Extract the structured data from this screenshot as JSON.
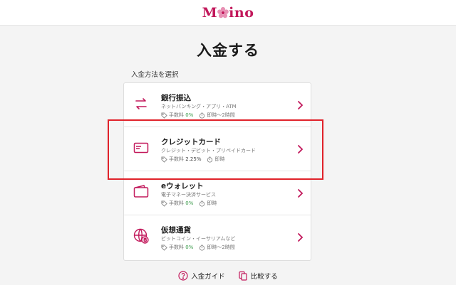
{
  "header": {
    "logo_text": "Mysino"
  },
  "page": {
    "title": "入金する",
    "section_label": "入金方法を選択"
  },
  "methods": [
    {
      "title": "銀行振込",
      "subtitle": "ネットバンキング・アプリ・ATM",
      "fee_label": "手数料",
      "fee_value": "0%",
      "time_label": "即時〜2時間",
      "icon": "bank-transfer-icon"
    },
    {
      "title": "クレジットカード",
      "subtitle": "クレジット・デビット・プリペイドカード",
      "fee_label": "手数料",
      "fee_value": "2.25%",
      "time_label": "即時",
      "icon": "credit-card-icon"
    },
    {
      "title": "eウォレット",
      "subtitle": "電子マネー決済サービス",
      "fee_label": "手数料",
      "fee_value": "0%",
      "time_label": "即時",
      "icon": "wallet-icon"
    },
    {
      "title": "仮想通貨",
      "subtitle": "ビットコイン・イーサリアムなど",
      "fee_label": "手数料",
      "fee_value": "0%",
      "time_label": "即時〜2時間",
      "icon": "crypto-icon"
    }
  ],
  "footer": {
    "guide_label": "入金ガイド",
    "compare_label": "比較する"
  },
  "colors": {
    "accent": "#c2185b",
    "highlight": "#e0222a",
    "fee_green": "#3a9a4a"
  }
}
